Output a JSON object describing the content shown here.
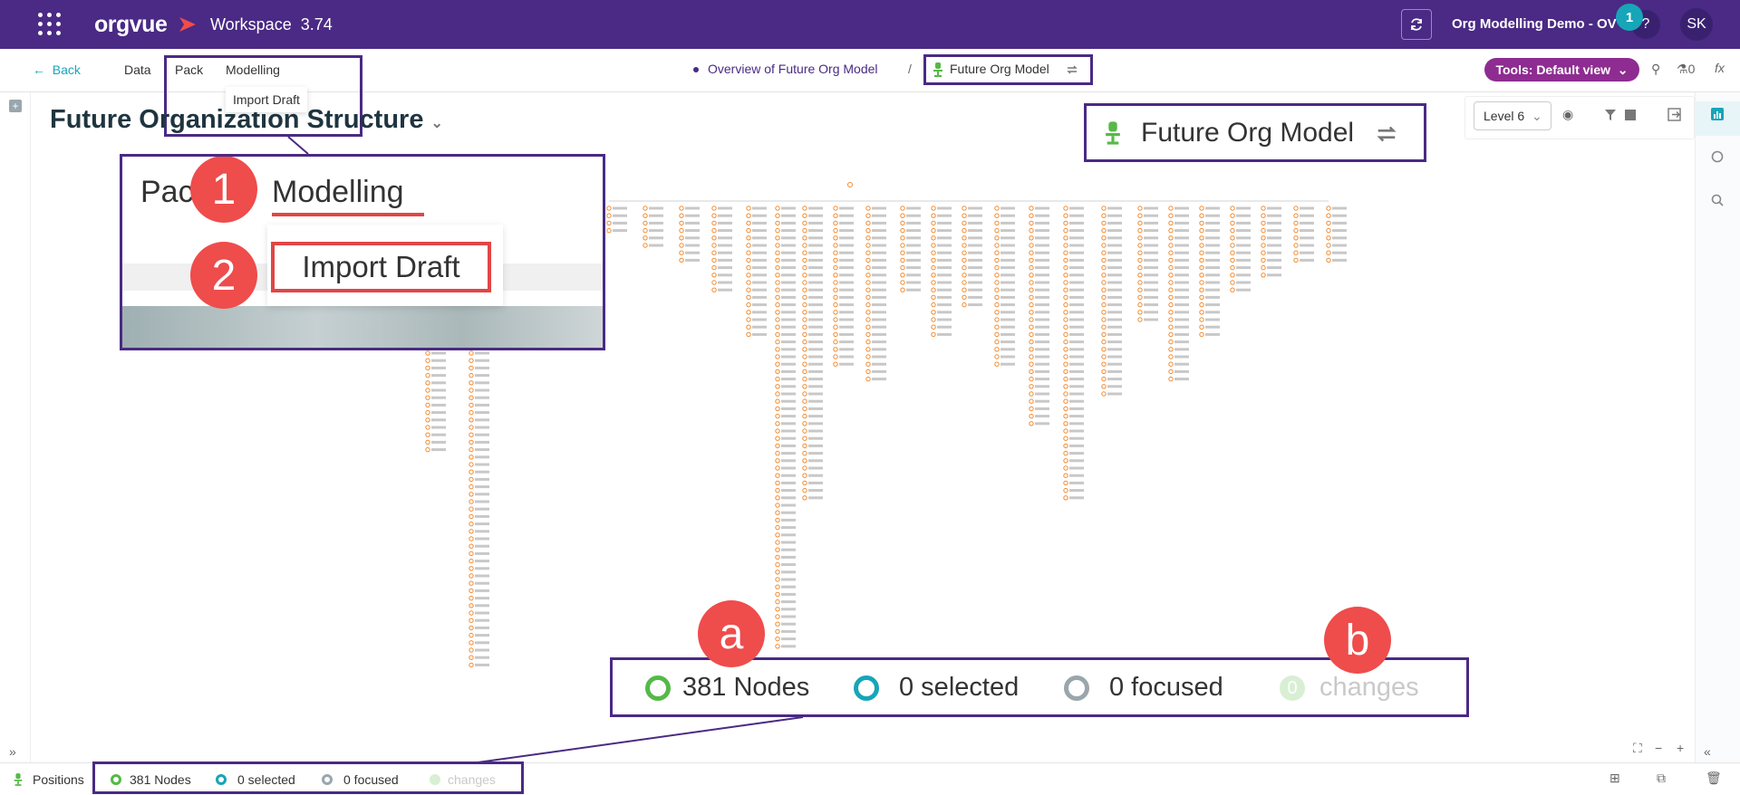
{
  "topbar": {
    "logo": "orgvue",
    "workspace": "Workspace",
    "version": "3.74",
    "demo_name": "Org Modelling Demo - OV",
    "notification_count": "1",
    "help": "?",
    "user_initials": "SK"
  },
  "navbar": {
    "back": "Back",
    "items": [
      "Data",
      "Pack",
      "Modelling"
    ],
    "dropdown_item": "Import Draft",
    "breadcrumb_parent": "Overview of Future Org Model",
    "breadcrumb_sep": "/",
    "breadcrumb_current": "Future Org Model",
    "tools_label": "Tools: Default view",
    "count": "0",
    "fx": "fx"
  },
  "page": {
    "title": "Future Organization Structure",
    "level": "Level 6"
  },
  "callouts": {
    "z1_pack": "Pack",
    "z1_modelling": "Modelling",
    "z1_import": "Import Draft",
    "z1_step1": "1",
    "z1_step2": "2",
    "z2_title": "Future Org Model",
    "z3_badge_a": "a",
    "z3_badge_b": "b"
  },
  "status": {
    "label": "Positions",
    "nodes": "381 Nodes",
    "selected": "0 selected",
    "focused": "0 focused",
    "changes_count": "0",
    "changes": "changes"
  },
  "colors": {
    "brand": "#4a2a84",
    "teal": "#17a5b8",
    "tools": "#8e2c91",
    "highlight_red": "#ef4c4c",
    "node_orange": "#f28a2e",
    "nodes_green": "#55b947"
  }
}
